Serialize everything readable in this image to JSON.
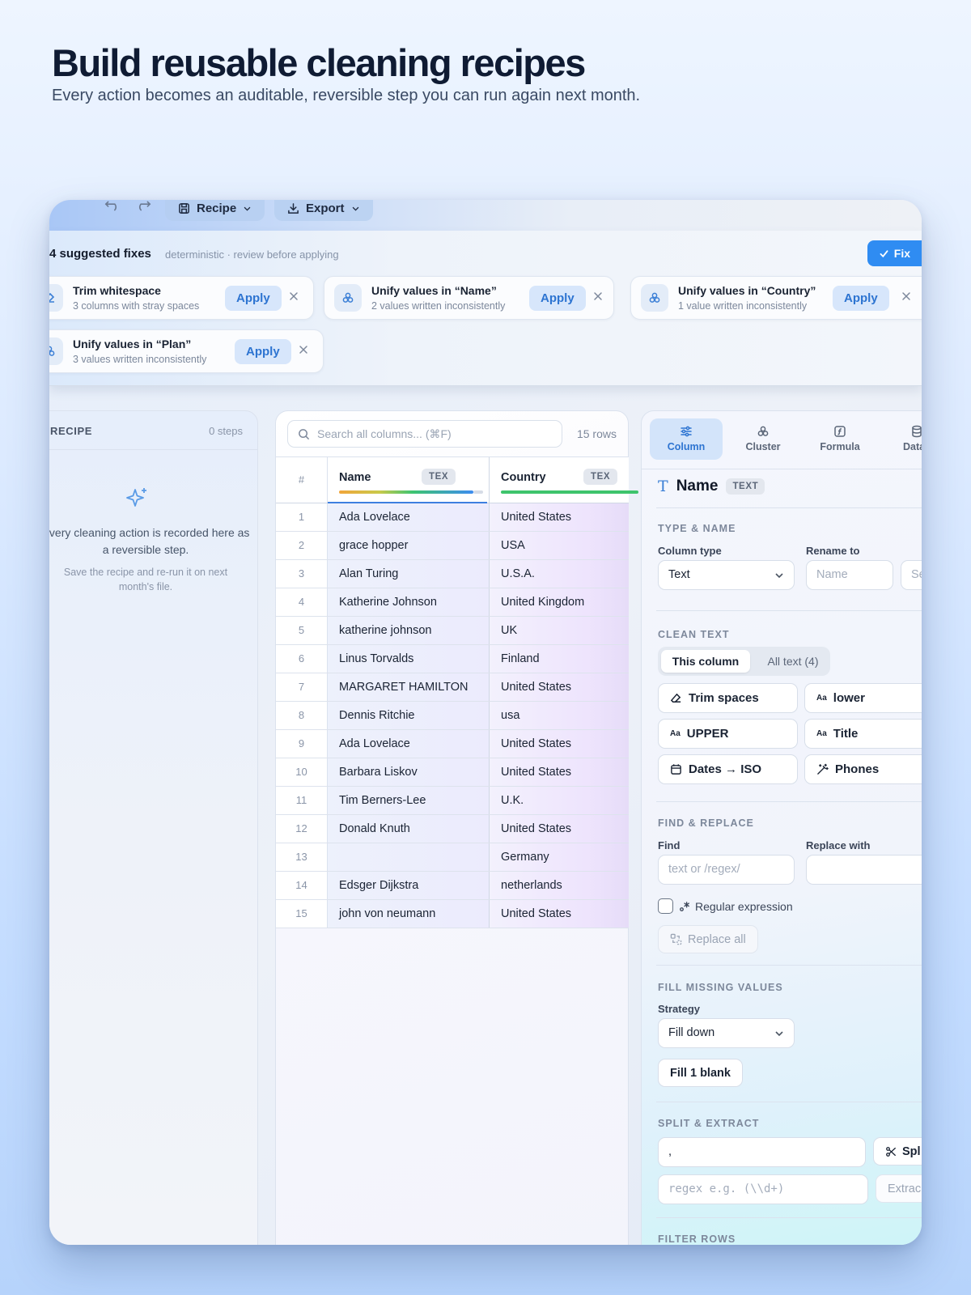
{
  "hero": {
    "title": "Build reusable cleaning recipes",
    "subtitle": "Every action becomes an auditable, reversible step you can run again next month."
  },
  "toolbar": {
    "undo_icon": "undo-icon",
    "redo_icon": "redo-icon",
    "recipe_label": "Recipe",
    "export_label": "Export"
  },
  "fixes": {
    "title": "4 suggested fixes",
    "note": "deterministic · review before applying",
    "fix_all_label": "Fix",
    "cards": [
      {
        "title": "Trim whitespace",
        "desc": "3 columns with stray spaces",
        "apply": "Apply",
        "icon": "eraser-icon"
      },
      {
        "title": "Unify values in “Name”",
        "desc": "2 values written inconsistently",
        "apply": "Apply",
        "icon": "cluster-icon"
      },
      {
        "title": "Unify values in “Country”",
        "desc": "1 value written inconsistently",
        "apply": "Apply",
        "icon": "cluster-icon"
      },
      {
        "title": "Unify values in “Plan”",
        "desc": "3 values written inconsistently",
        "apply": "Apply",
        "icon": "cluster-icon"
      }
    ]
  },
  "recipe": {
    "heading": "RECIPE",
    "steps": "0 steps",
    "empty_primary": "Every cleaning action is recorded here as a reversible step.",
    "empty_secondary": "Save the recipe and re-run it on next month's file."
  },
  "table": {
    "search_placeholder": "Search all columns...  (⌘F)",
    "row_count": "15 rows",
    "num_header": "#",
    "columns": [
      {
        "name": "Name",
        "type": "TEX"
      },
      {
        "name": "Country",
        "type": "TEX"
      }
    ],
    "rows": [
      {
        "n": "1",
        "name": "Ada Lovelace",
        "country": "United States"
      },
      {
        "n": "2",
        "name": "grace hopper",
        "country": "USA"
      },
      {
        "n": "3",
        "name": "Alan Turing",
        "country": "U.S.A."
      },
      {
        "n": "4",
        "name": "Katherine Johnson",
        "country": "United Kingdom"
      },
      {
        "n": "5",
        "name": "katherine johnson",
        "country": "UK"
      },
      {
        "n": "6",
        "name": "Linus Torvalds",
        "country": "Finland"
      },
      {
        "n": "7",
        "name": "MARGARET HAMILTON",
        "country": "United States"
      },
      {
        "n": "8",
        "name": "Dennis Ritchie",
        "country": "usa"
      },
      {
        "n": "9",
        "name": "Ada Lovelace",
        "country": "United States"
      },
      {
        "n": "10",
        "name": "Barbara Liskov",
        "country": "United States"
      },
      {
        "n": "11",
        "name": "Tim Berners-Lee",
        "country": "U.K."
      },
      {
        "n": "12",
        "name": "Donald Knuth",
        "country": "United States"
      },
      {
        "n": "13",
        "name": "",
        "country": "Germany"
      },
      {
        "n": "14",
        "name": "Edsger Dijkstra",
        "country": "netherlands"
      },
      {
        "n": "15",
        "name": "john von neumann",
        "country": "United States"
      }
    ]
  },
  "inspector": {
    "tabs": [
      {
        "label": "Column",
        "active": true
      },
      {
        "label": "Cluster"
      },
      {
        "label": "Formula"
      },
      {
        "label": "Datas"
      }
    ],
    "column_name": "Name",
    "column_tag": "TEXT",
    "type_name": {
      "section": "TYPE & NAME",
      "type_label": "Column type",
      "type_value": "Text",
      "rename_label": "Rename to",
      "rename_placeholder": "Name",
      "extra_placeholder": "Se"
    },
    "clean_text": {
      "section": "CLEAN TEXT",
      "scope_this": "This column",
      "scope_all": "All text (4)",
      "trim": "Trim spaces",
      "lower": "lower",
      "upper": "UPPER",
      "title": "Title",
      "dates": "Dates → ISO",
      "phones": "Phones",
      "case_glyph": "Aa"
    },
    "find_replace": {
      "section": "FIND & REPLACE",
      "find_label": "Find",
      "find_placeholder": "text or /regex/",
      "replace_label": "Replace with",
      "regex_label": "Regular expression",
      "replace_all": "Replace all"
    },
    "fill_missing": {
      "section": "FILL MISSING VALUES",
      "strategy_label": "Strategy",
      "strategy_value": "Fill down",
      "fill_button": "Fill 1 blank"
    },
    "split_extract": {
      "section": "SPLIT & EXTRACT",
      "delimiter_value": ",",
      "split_button": "Spl",
      "regex_placeholder": "regex e.g. (\\\\d+)",
      "extract_button": "Extrac"
    },
    "filter_rows": {
      "section": "FILTER ROWS"
    }
  }
}
